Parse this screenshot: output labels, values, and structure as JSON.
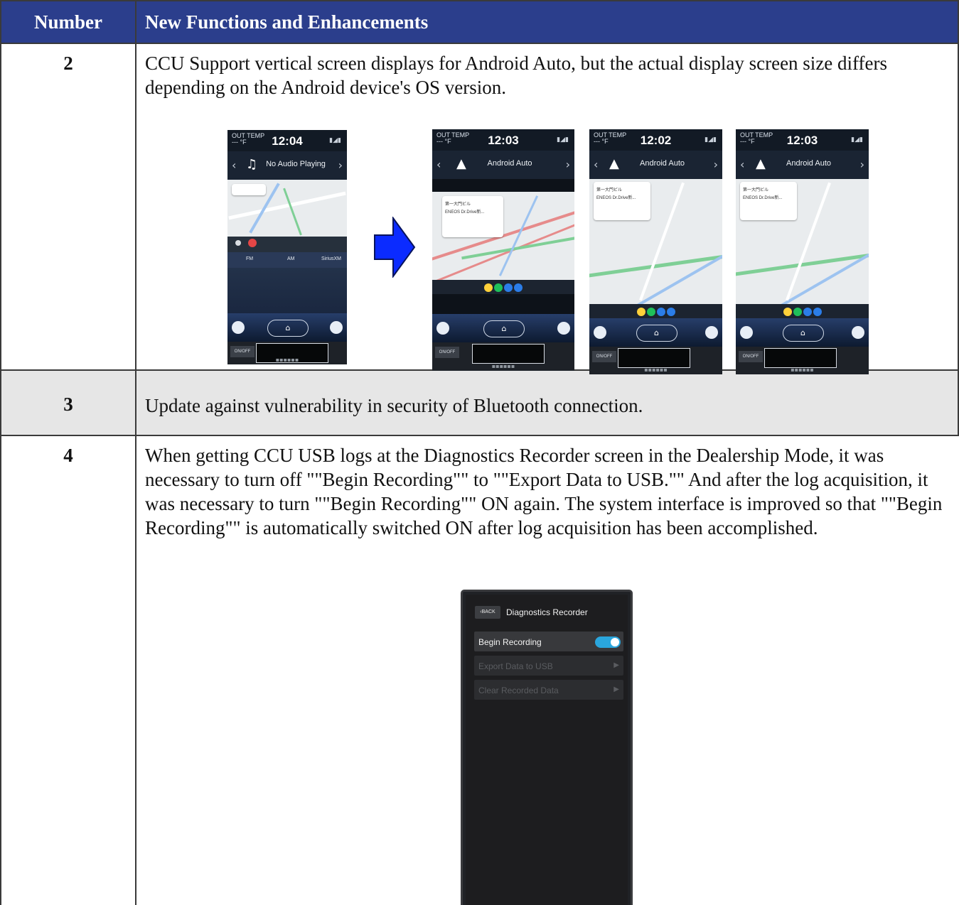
{
  "table": {
    "headers": [
      "Number",
      "New Functions and Enhancements"
    ],
    "rows": [
      {
        "number": "2",
        "text": "CCU Support vertical screen displays for Android Auto, but the actual display screen size differs depending on the Android device's OS version."
      },
      {
        "number": "3",
        "text": "Update against vulnerability in security of Bluetooth connection."
      },
      {
        "number": "4",
        "text": "When getting CCU USB logs at the Diagnostics Recorder screen in the Dealership Mode, it was necessary to turn off \"\"Begin Recording\"\" to \"\"Export Data to USB.\"\" And after the log acquisition, it was necessary to turn \"\"Begin Recording\"\" ON again. The system interface is improved so that \"\"Begin Recording\"\" is automatically switched ON after log acquisition has been accomplished."
      }
    ]
  },
  "screens": {
    "before": {
      "temp": "OUT TEMP\n--- °F",
      "clock": "12:04",
      "title": "No Audio Playing",
      "tabs": [
        "FM",
        "AM",
        "SiriusXM"
      ],
      "onoff": "ON/OFF"
    },
    "after1": {
      "temp": "OUT TEMP\n--- °F",
      "clock": "12:03",
      "title": "Android Auto",
      "onoff": "ON/OFF"
    },
    "after2": {
      "temp": "OUT TEMP\n--- °F",
      "clock": "12:02",
      "title": "Android Auto",
      "onoff": "ON/OFF"
    },
    "after3": {
      "temp": "OUT TEMP\n--- °F",
      "clock": "12:03",
      "title": "Android Auto",
      "onoff": "ON/OFF"
    },
    "card_lines": [
      "第一大門ビル",
      "ENEOS Dr.Drive新..."
    ]
  },
  "diagnostics": {
    "back": "BACK",
    "title": "Diagnostics Recorder",
    "items": [
      "Begin Recording",
      "Export Data to USB",
      "Clear Recorded Data"
    ],
    "begin_recording_on": true
  },
  "colors": {
    "header_bg": "#2b3e8c",
    "shaded_row": "#e6e6e6",
    "arrow": "#0b2bff",
    "toggle_on": "#2aa6dd"
  }
}
